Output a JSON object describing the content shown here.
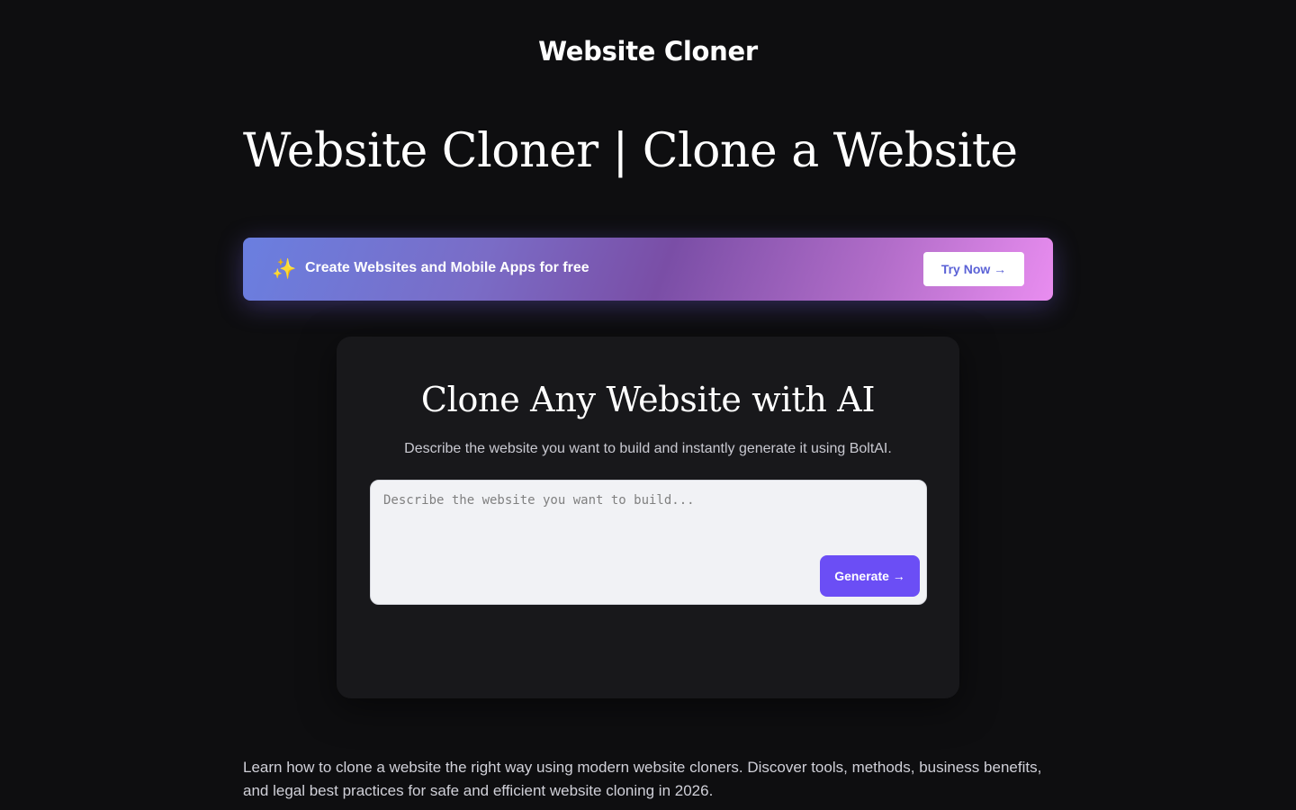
{
  "header": {
    "site_title": "Website Cloner"
  },
  "hero": {
    "title": "Website Cloner | Clone a Website"
  },
  "promo": {
    "icon": "sparkles-icon",
    "icon_glyph": "✨",
    "text": "Create Websites and Mobile Apps for free",
    "cta_label": "Try Now →",
    "gradient_start": "#6a7fe0",
    "gradient_end": "#e98df0"
  },
  "clone_card": {
    "title": "Clone Any Website with AI",
    "subtitle": "Describe the website you want to build and instantly generate it using BoltAI.",
    "input_value": "",
    "input_placeholder": "Describe the website you want to build...",
    "generate_label": "Generate →",
    "accent_color": "#6b4ef5"
  },
  "intro": {
    "text": "Learn how to clone a website the right way using modern website cloners. Discover tools, methods, business benefits, and legal best practices for safe and efficient website cloning in 2026."
  },
  "colors": {
    "background": "#0e0e10",
    "card_background": "#18181b"
  }
}
